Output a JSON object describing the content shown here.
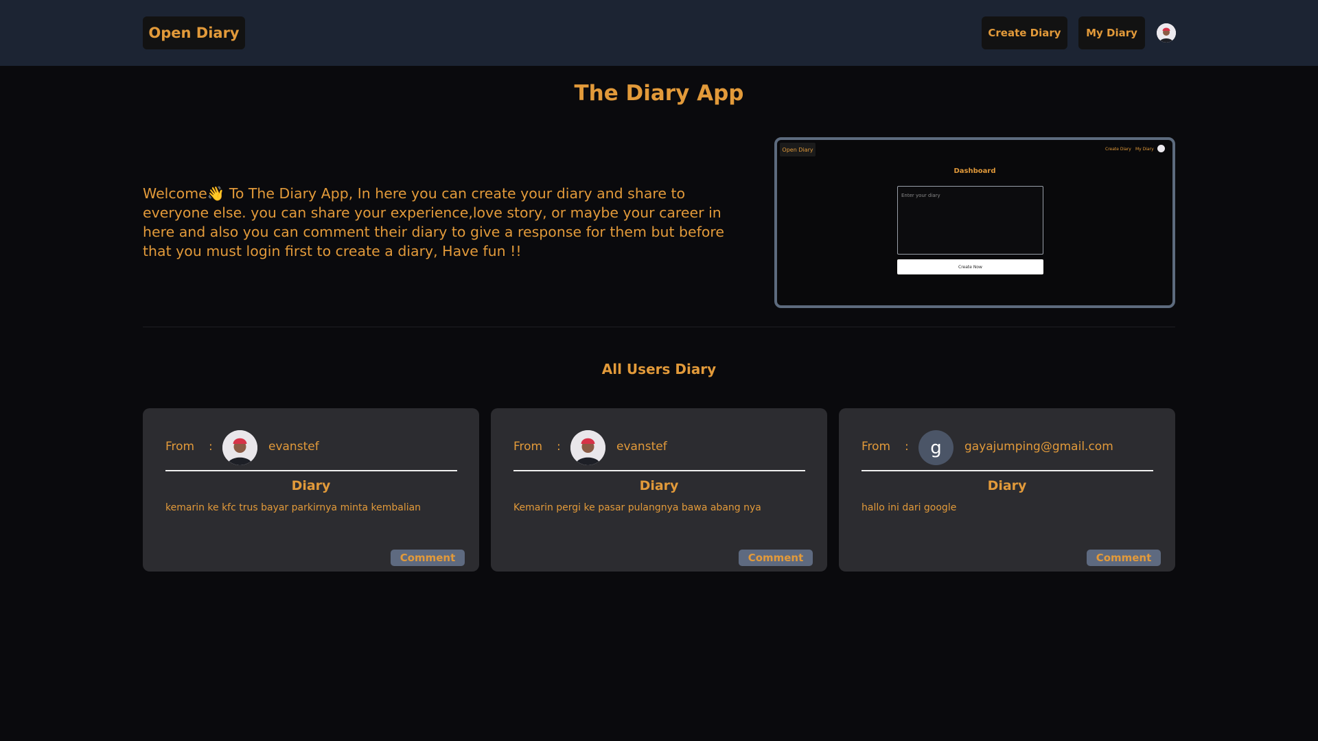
{
  "header": {
    "brand": "Open Diary",
    "nav": {
      "create": "Create Diary",
      "my": "My Diary"
    }
  },
  "hero": {
    "title": "The Diary App",
    "intro": "Welcome👋 To The Diary App, In here you can create your diary and share to everyone else. you can share your experience,love story, or maybe your career in here and also you can comment their diary to give a response for them but before that you must login first to create a diary, Have fun !!"
  },
  "preview": {
    "brand": "Open Diary",
    "nav_create": "Create Diary",
    "nav_my": "My Diary",
    "title": "Dashboard",
    "placeholder": "Enter your diary",
    "button": "Create Now"
  },
  "section": {
    "title": "All Users Diary"
  },
  "cards": [
    {
      "from_label": "From",
      "colon": ":",
      "username": "evanstef",
      "avatar": "photo-avatar",
      "heading": "Diary",
      "text": "kemarin ke kfc trus bayar parkirnya minta kembalian",
      "comment": "Comment"
    },
    {
      "from_label": "From",
      "colon": ":",
      "username": "evanstef",
      "avatar": "photo-avatar",
      "heading": "Diary",
      "text": "Kemarin pergi ke pasar pulangnya bawa abang nya",
      "comment": "Comment"
    },
    {
      "from_label": "From",
      "colon": ":",
      "username": "gayajumping@gmail.com",
      "avatar": "letter-avatar",
      "avatar_letter": "g",
      "heading": "Diary",
      "text": "hallo ini dari google",
      "comment": "Comment"
    }
  ],
  "colors": {
    "accent": "#e29a3a",
    "header_bg": "#1c2433",
    "page_bg": "#0a0a0d",
    "card_bg": "#2c2c30",
    "comment_bg": "#5e6a80"
  }
}
